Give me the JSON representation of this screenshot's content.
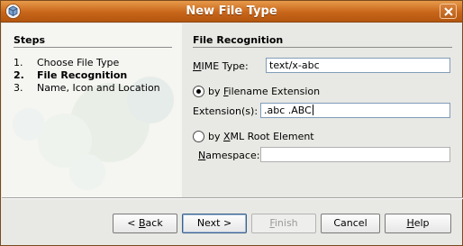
{
  "window": {
    "title": "New File Type"
  },
  "steps": {
    "heading": "Steps",
    "items": [
      {
        "num": "1.",
        "label": "Choose File Type"
      },
      {
        "num": "2.",
        "label": "File Recognition"
      },
      {
        "num": "3.",
        "label": "Name, Icon and Location"
      }
    ]
  },
  "panel": {
    "heading": "File Recognition",
    "mime_label_mn": "M",
    "mime_label_rest": "IME Type:",
    "mime_value": "text/x-abc",
    "by_ext_pre": "by ",
    "by_ext_mn": "F",
    "by_ext_rest": "ilename Extension",
    "ext_label": "Extension(s):",
    "ext_value": ".abc .ABC",
    "by_xml_pre": "by ",
    "by_xml_mn": "X",
    "by_xml_rest": "ML Root Element",
    "ns_label_mn": "N",
    "ns_label_rest": "amespace:",
    "ns_value": ""
  },
  "buttons": {
    "back_pre": "< ",
    "back_mn": "B",
    "back_rest": "ack",
    "next": "Next >",
    "finish_mn": "F",
    "finish_rest": "inish",
    "cancel": "Cancel",
    "help_mn": "H",
    "help_rest": "elp"
  },
  "colors": {
    "title_bar": "#c8661a",
    "dialog_bg": "#e8e8e4",
    "focus_border": "#7f9db9"
  },
  "icons": {
    "app": "netbeans-cube-icon",
    "close": "close-x-icon"
  }
}
